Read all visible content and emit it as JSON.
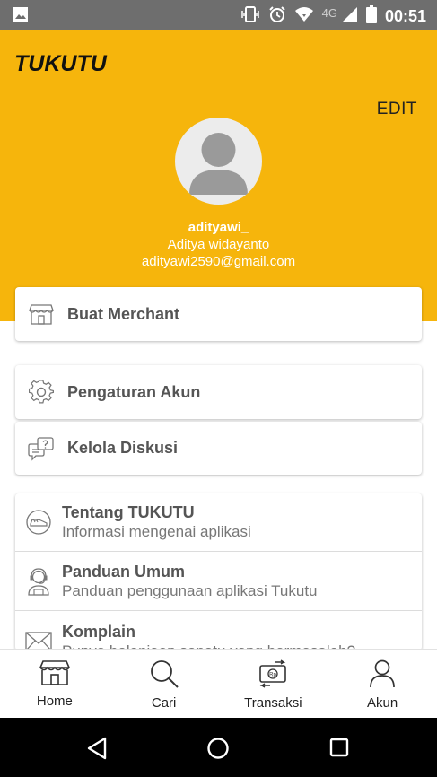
{
  "status_bar": {
    "network": "4G",
    "time": "00:51"
  },
  "header": {
    "logo": "TUKUTU",
    "edit_label": "EDIT",
    "username": "adityawi_",
    "full_name": "Aditya widayanto",
    "email": "adityawi2590@gmail.com"
  },
  "menu": {
    "merchant": {
      "label": "Buat Merchant",
      "icon": "store-icon"
    },
    "settings": {
      "label": "Pengaturan Akun",
      "icon": "gear-icon"
    },
    "discussion": {
      "label": "Kelola Diskusi",
      "icon": "chat-question-icon"
    },
    "info_items": [
      {
        "title": "Tentang TUKUTU",
        "subtitle": "Informasi mengenai aplikasi",
        "icon": "shoe-icon"
      },
      {
        "title": "Panduan Umum",
        "subtitle": "Panduan penggunaan aplikasi Tukutu",
        "icon": "operator-icon"
      },
      {
        "title": "Komplain",
        "subtitle": "Punya belanjaan sepatu yang bermasalah?",
        "icon": "mail-icon"
      }
    ]
  },
  "bottom_nav": [
    {
      "label": "Home",
      "icon": "store-icon"
    },
    {
      "label": "Cari",
      "icon": "search-icon"
    },
    {
      "label": "Transaksi",
      "icon": "money-transfer-icon"
    },
    {
      "label": "Akun",
      "icon": "user-icon"
    }
  ],
  "colors": {
    "accent": "#f6b50c",
    "status_bar": "#6e6e6e",
    "text_muted": "#777777"
  }
}
